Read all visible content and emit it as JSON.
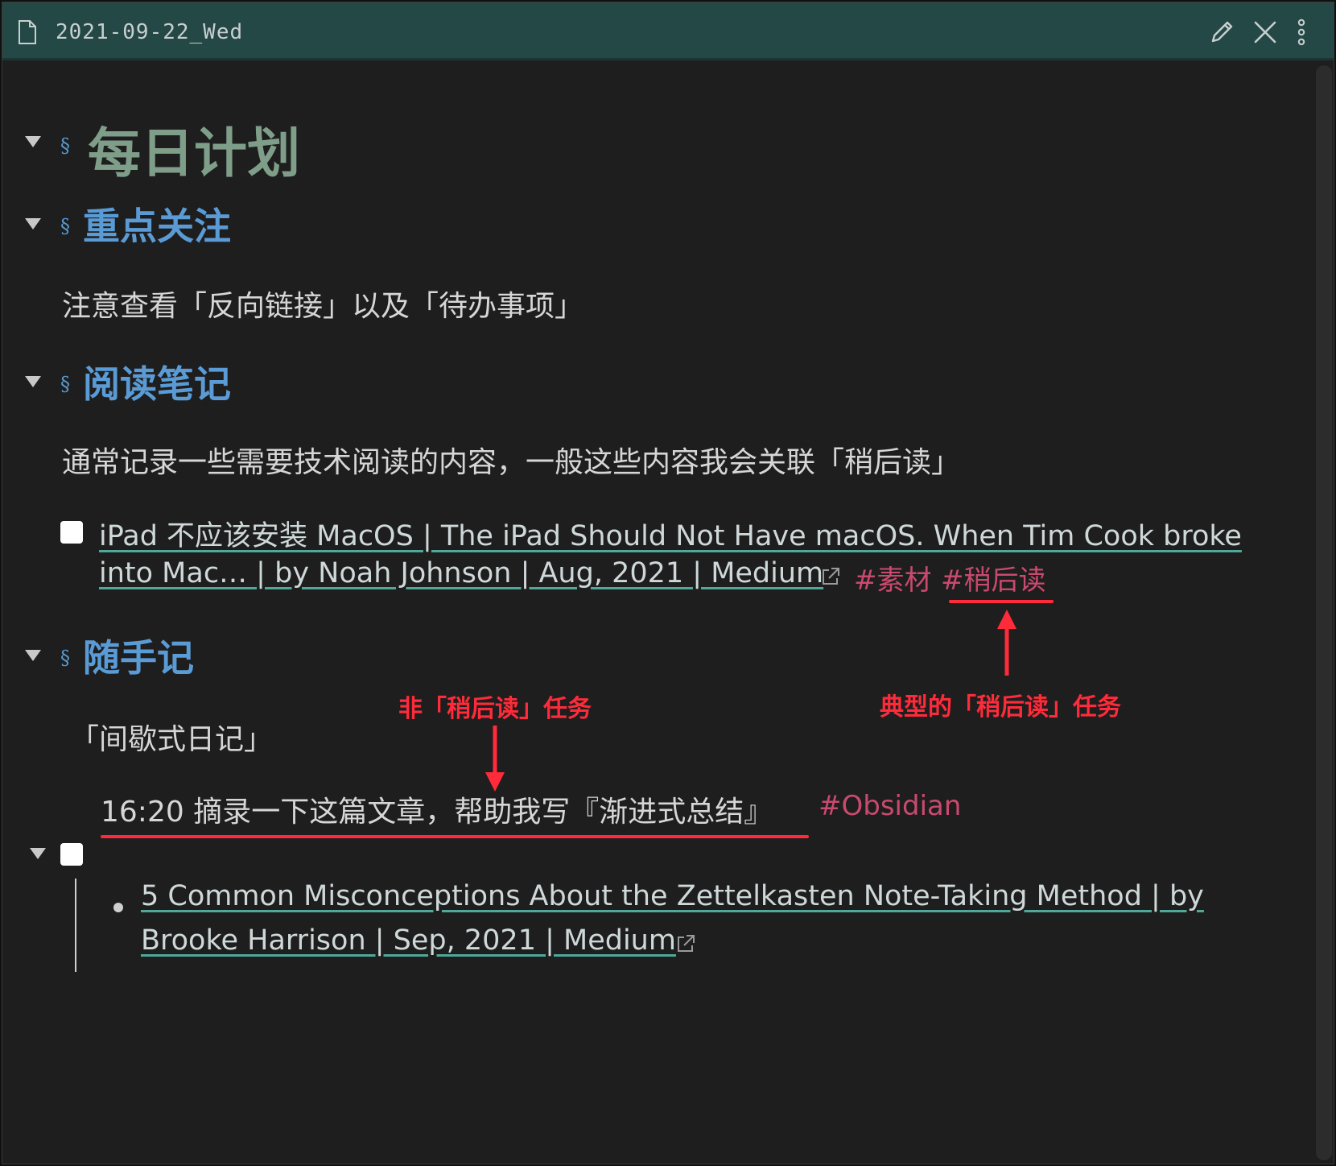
{
  "window": {
    "title": "2021-09-22_Wed",
    "titlebar_color": "#244846",
    "icons": [
      "file-icon",
      "pencil-icon",
      "close-icon",
      "more-vertical-icon"
    ]
  },
  "note": {
    "h1": "每日计划",
    "section_focus": {
      "heading": "重点关注",
      "text": "注意查看「反向链接」以及「待办事项」"
    },
    "section_reading": {
      "heading": "阅读笔记",
      "text": "通常记录一些需要技术阅读的内容，一般这些内容我会关联「稍后读」",
      "task": {
        "link_line1": "iPad 不应该安装 MacOS | The iPad Should Not Have macOS. When Tim Cook broke",
        "link_line2": "into Mac… | by Noah Johnson | Aug, 2021 | Medium",
        "tag1": "#素材",
        "tag2": "#稍后读"
      }
    },
    "section_jot": {
      "heading": "随手记",
      "text": "「间歇式日记」",
      "task": {
        "text": "16:20 摘录一下这篇文章，帮助我写『渐进式总结』",
        "tag": "#Obsidian",
        "child_line1": "5 Common Misconceptions About the Zettelkasten Note-Taking Method | by",
        "child_line2": "Brooke Harrison | Sep, 2021 | Medium"
      }
    }
  },
  "annotations": {
    "typical_read_later": "典型的「稍后读」任务",
    "non_read_later": "非「稍后读」任务",
    "color": "#ff2b3a"
  },
  "colors": {
    "background": "#1e1e1e",
    "h1": "#7f9e89",
    "h2": "#5a9bd5",
    "tag": "#c94a6e",
    "link_underline": "#4fa89a"
  }
}
